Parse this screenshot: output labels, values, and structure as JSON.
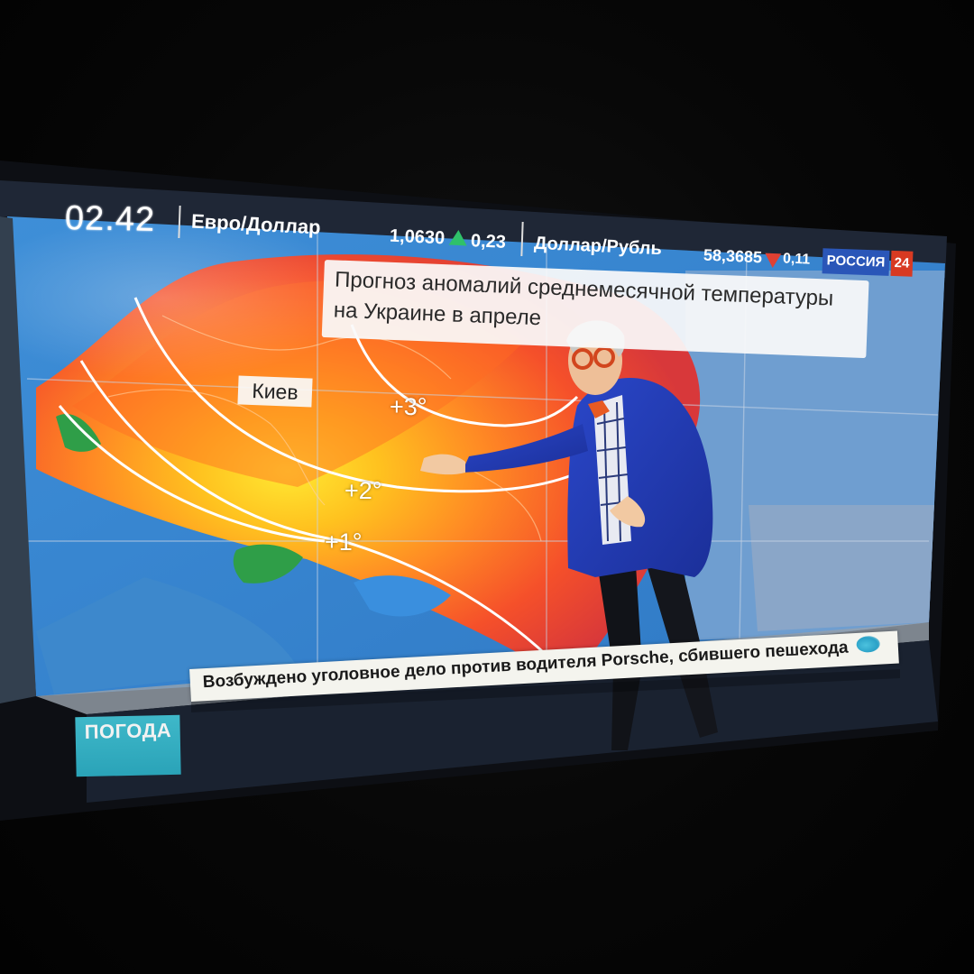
{
  "broadcast": {
    "clock": "02.42",
    "currency": [
      {
        "pair": "Евро/Доллар",
        "value": "1,0630",
        "change": "0,23",
        "direction": "up",
        "direction_color": "#2fc16a"
      },
      {
        "pair": "Доллар/Рубль",
        "value": "58,3685",
        "change": "0,11",
        "direction": "down",
        "direction_color": "#e04032"
      }
    ],
    "channel": {
      "name": "РОССИЯ",
      "number": "24",
      "name_color": "#2a56b8",
      "number_color": "#d83a22"
    }
  },
  "forecast": {
    "title_line1": "Прогноз аномалий среднемесячной температуры",
    "title_line2": "на Украине в апреле",
    "city": "Киев",
    "isolines": [
      "+3°",
      "+2°",
      "+1°"
    ]
  },
  "weather_tag": {
    "label": "ПОГОДА",
    "color": "#2aa3b8"
  },
  "ticker": {
    "text": "Возбуждено уголовное дело против водителя Porsche, сбившего пешехода"
  }
}
